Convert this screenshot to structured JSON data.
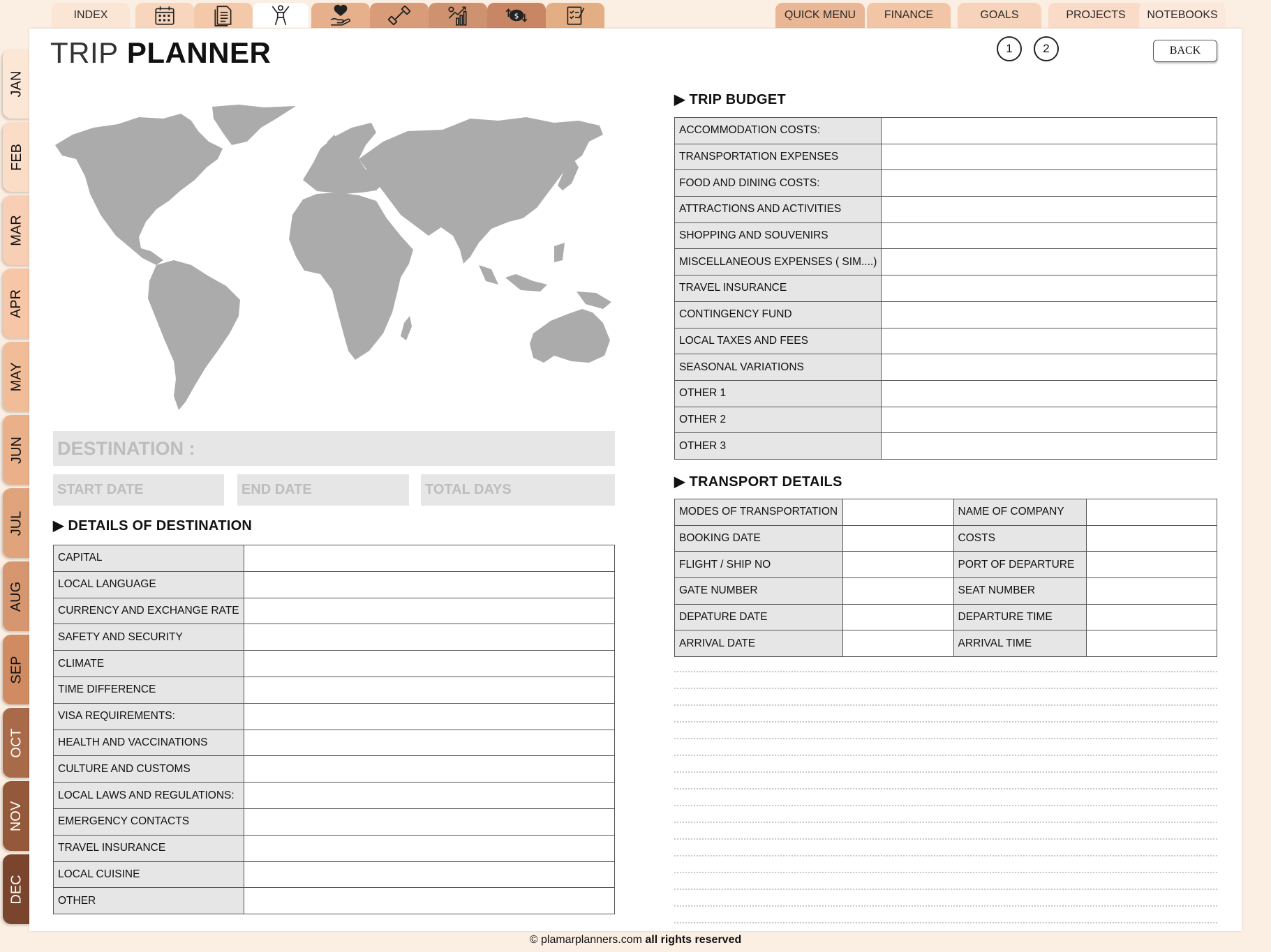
{
  "top_tabs": {
    "index": "INDEX",
    "icons": [
      "calendar-icon",
      "document-icon",
      "person-icon",
      "heart-hand-icon",
      "dumbbell-icon",
      "growth-chart-icon",
      "money-exchange-icon",
      "checklist-icon"
    ],
    "right": [
      "QUICK MENU",
      "FINANCE",
      "GOALS",
      "PROJECTS",
      "NOTEBOOKS"
    ]
  },
  "months": [
    "JAN",
    "FEB",
    "MAR",
    "APR",
    "MAY",
    "JUN",
    "JUL",
    "AUG",
    "SEP",
    "OCT",
    "NOV",
    "DEC"
  ],
  "header": {
    "title_light": "TRIP",
    "title_bold": "PLANNER",
    "pages": [
      "1",
      "2"
    ],
    "back": "BACK"
  },
  "destination": {
    "label": "DESTINATION :",
    "start_date": "START DATE",
    "end_date": "END DATE",
    "total_days": "TOTAL DAYS"
  },
  "details": {
    "heading": "▶ DETAILS OF DESTINATION",
    "rows": [
      "CAPITAL",
      "LOCAL LANGUAGE",
      "CURRENCY AND EXCHANGE RATE",
      "SAFETY AND SECURITY",
      "CLIMATE",
      "TIME DIFFERENCE",
      "VISA REQUIREMENTS:",
      "HEALTH AND VACCINATIONS",
      "CULTURE AND CUSTOMS",
      "LOCAL LAWS AND REGULATIONS:",
      "EMERGENCY CONTACTS",
      "TRAVEL INSURANCE",
      "LOCAL CUISINE",
      "OTHER"
    ]
  },
  "budget": {
    "heading": "▶ TRIP BUDGET",
    "rows": [
      "ACCOMMODATION COSTS:",
      "TRANSPORTATION EXPENSES",
      "FOOD AND DINING COSTS:",
      "ATTRACTIONS AND ACTIVITIES",
      "SHOPPING AND SOUVENIRS",
      "MISCELLANEOUS EXPENSES ( SIM....)",
      "TRAVEL INSURANCE",
      "CONTINGENCY FUND",
      "LOCAL TAXES AND FEES",
      "SEASONAL VARIATIONS",
      "OTHER 1",
      "OTHER 2",
      "OTHER 3"
    ]
  },
  "transport": {
    "heading": "▶ TRANSPORT DETAILS",
    "rows": [
      [
        "MODES OF TRANSPORTATION",
        "NAME OF COMPANY"
      ],
      [
        "BOOKING DATE",
        "COSTS"
      ],
      [
        "FLIGHT / SHIP NO",
        "PORT OF DEPARTURE"
      ],
      [
        "GATE NUMBER",
        "SEAT NUMBER"
      ],
      [
        "DEPATURE DATE",
        "DEPARTURE TIME"
      ],
      [
        "ARRIVAL DATE",
        "ARRIVAL TIME"
      ]
    ]
  },
  "footer": {
    "site": "© plamarplanners.com",
    "rights": "all rights reserved"
  },
  "colors": {
    "background": "#fbeee2",
    "label_fill": "#e6e6e6",
    "map_gray": "#ababab"
  }
}
